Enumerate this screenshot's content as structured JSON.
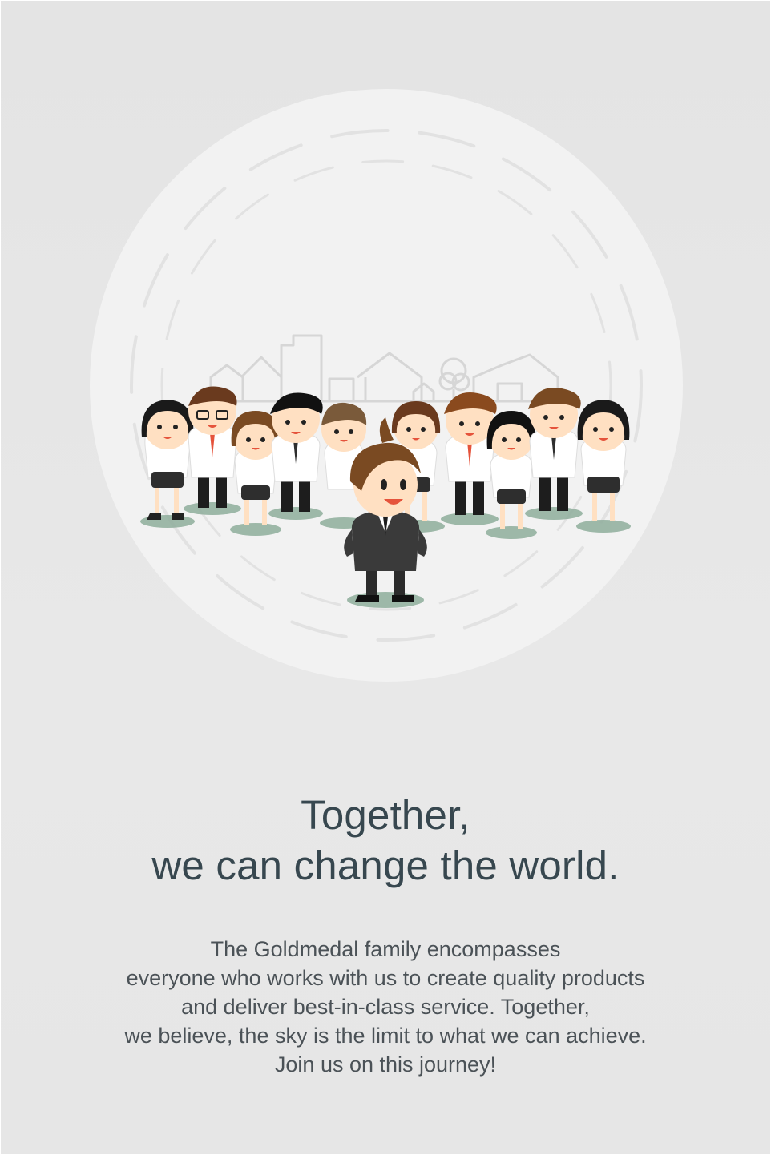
{
  "headline": {
    "line1": "Together,",
    "line2": "we can change the world."
  },
  "body": {
    "lines": [
      "The Goldmedal family encompasses",
      "everyone who works with us to create quality products",
      "and deliver best-in-class service. Together,",
      "we believe, the sky is the limit to what we can achieve.",
      "Join us on this journey!"
    ]
  },
  "colors": {
    "background": "#e6e6e6",
    "circle": "#f2f2f2",
    "text_dark": "#37474f",
    "text_body": "#4b5257",
    "shirt": "#ffffff",
    "suit": "#3a3a3a",
    "tie_red": "#e5533b",
    "ground_shadow": "#8fae9c"
  },
  "illustration": {
    "icon": "team-group-illustration"
  }
}
